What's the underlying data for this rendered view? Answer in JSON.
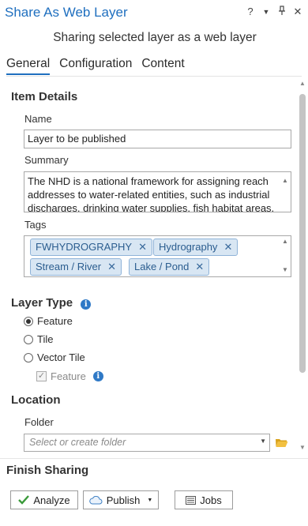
{
  "window": {
    "title": "Share As Web Layer",
    "controls": {
      "help": "?",
      "menu": "▼",
      "pin": "⊥",
      "close": "✕"
    }
  },
  "subtitle": "Sharing selected layer as a web layer",
  "tabs": [
    {
      "label": "General",
      "active": true
    },
    {
      "label": "Configuration",
      "active": false
    },
    {
      "label": "Content",
      "active": false
    }
  ],
  "item_details": {
    "heading": "Item Details",
    "name_label": "Name",
    "name_value": "Layer to be published",
    "summary_label": "Summary",
    "summary_lines": [
      "The NHD is a national framework for assigning reach",
      "addresses to water-related entities, such as industrial",
      "discharges, drinking water supplies, fish habitat areas,"
    ],
    "tags_label": "Tags",
    "tags": [
      "FWHYDROGRAPHY",
      "Hydrography",
      "Stream / River",
      "Lake / Pond"
    ]
  },
  "layer_type": {
    "heading": "Layer Type",
    "options": [
      {
        "label": "Feature",
        "selected": true
      },
      {
        "label": "Tile",
        "selected": false
      },
      {
        "label": "Vector Tile",
        "selected": false
      }
    ],
    "sub_option": {
      "label": "Feature",
      "checked": true,
      "enabled": false
    }
  },
  "location": {
    "heading": "Location",
    "folder_label": "Folder",
    "folder_placeholder": "Select or create folder"
  },
  "finish": {
    "heading": "Finish Sharing",
    "analyze_label": "Analyze",
    "publish_label": "Publish",
    "jobs_label": "Jobs"
  },
  "colors": {
    "accent": "#1f6fbf",
    "tag_bg": "#d8e6f3",
    "tag_border": "#8fb3d8",
    "check_green": "#3a9a3a"
  }
}
